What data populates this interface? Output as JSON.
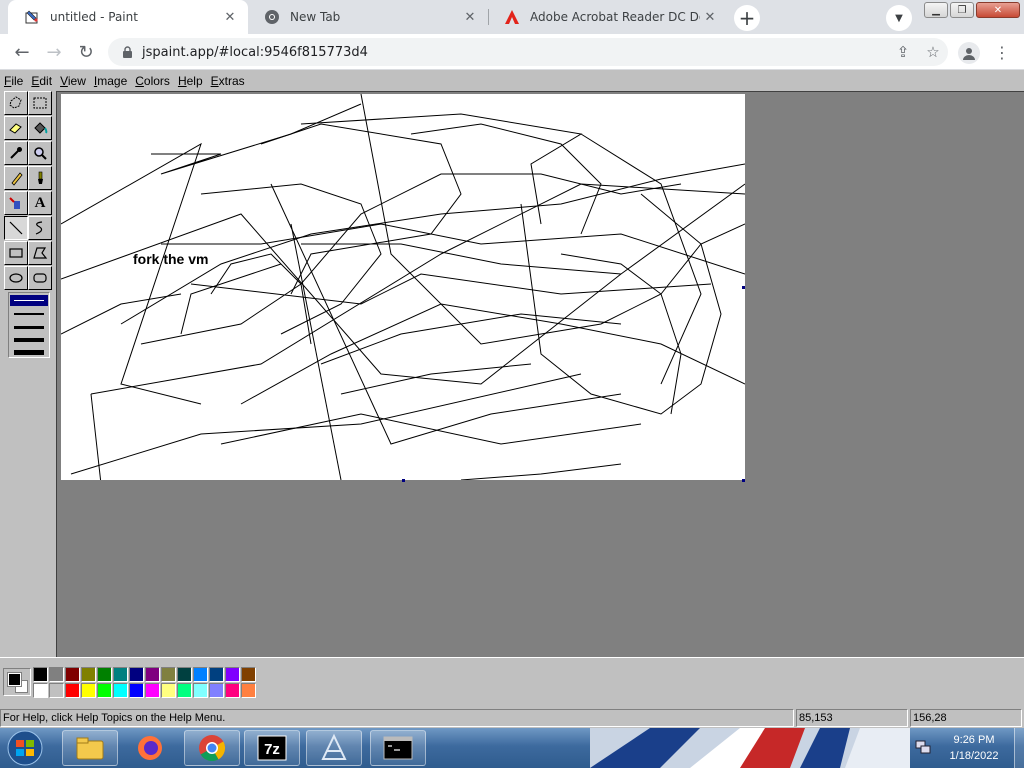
{
  "browser": {
    "tabs": [
      {
        "title": "untitled - Paint",
        "favicon": "paint-icon",
        "active": true
      },
      {
        "title": "New Tab",
        "favicon": "chrome-icon",
        "active": false
      },
      {
        "title": "Adobe Acrobat Reader DC Down",
        "favicon": "acrobat-icon",
        "active": false
      }
    ],
    "url": "jspaint.app/#local:9546f815773d4"
  },
  "paint": {
    "menus": [
      {
        "label": "File",
        "key": "F",
        "rest": "ile"
      },
      {
        "label": "Edit",
        "key": "E",
        "rest": "dit"
      },
      {
        "label": "View",
        "key": "V",
        "rest": "iew"
      },
      {
        "label": "Image",
        "key": "I",
        "rest": "mage"
      },
      {
        "label": "Colors",
        "key": "C",
        "rest": "olors"
      },
      {
        "label": "Help",
        "key": "H",
        "rest": "elp"
      },
      {
        "label": "Extras",
        "key": "E",
        "rest": "xtras"
      }
    ],
    "tools": [
      "free-form-select",
      "rectangle-select",
      "eraser",
      "fill-with-color",
      "pick-color",
      "magnifier",
      "pencil",
      "brush",
      "airbrush",
      "text",
      "line",
      "curve",
      "rectangle",
      "polygon",
      "ellipse",
      "rounded-rectangle"
    ],
    "selected_tool": "line",
    "canvas_text": "fork the vm",
    "foreground_color": "#000000",
    "background_color": "#ffffff",
    "palette": [
      "#000000",
      "#808080",
      "#800000",
      "#808000",
      "#008000",
      "#008080",
      "#000080",
      "#800080",
      "#808040",
      "#004040",
      "#0080ff",
      "#004080",
      "#8000ff",
      "#804000",
      "#ffffff",
      "#c0c0c0",
      "#ff0000",
      "#ffff00",
      "#00ff00",
      "#00ffff",
      "#0000ff",
      "#ff00ff",
      "#ffff80",
      "#00ff80",
      "#80ffff",
      "#8080ff",
      "#ff0080",
      "#ff8040"
    ],
    "status": {
      "help": "For Help, click Help Topics on the Help Menu.",
      "cursor": "85,153",
      "size": "156,28"
    }
  },
  "taskbar": {
    "time": "9:26 PM",
    "date": "1/18/2022",
    "pinned": [
      "explorer-icon",
      "firefox-icon",
      "chrome-icon",
      "7zip-icon",
      "app-icon",
      "cmd-icon"
    ]
  }
}
